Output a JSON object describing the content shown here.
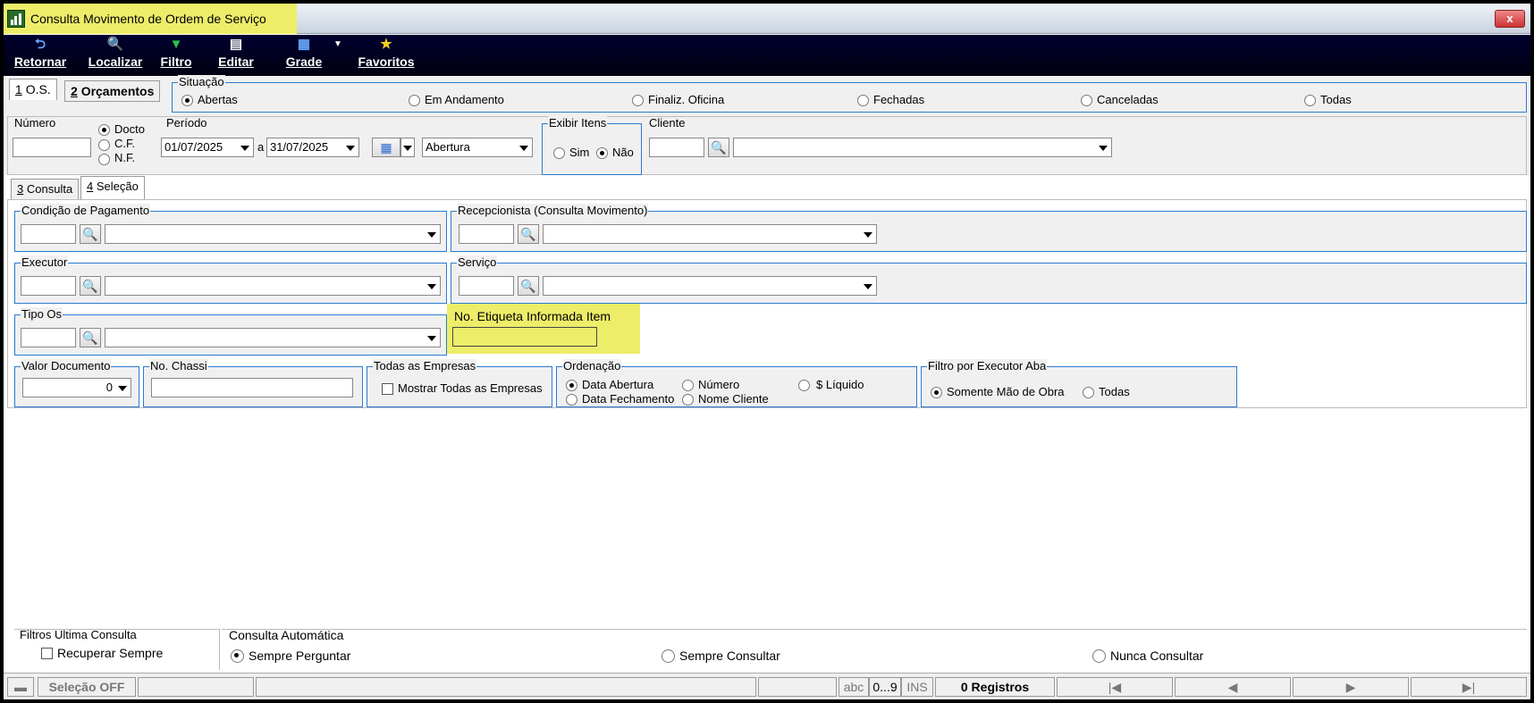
{
  "window": {
    "title": "Consulta Movimento de Ordem de Serviço",
    "close_label": "x"
  },
  "toolbar": {
    "retornar": "Retornar",
    "localizar": "Localizar",
    "filtro": "Filtro",
    "editar": "Editar",
    "grade": "Grade",
    "favoritos": "Favoritos"
  },
  "tabs_top": [
    {
      "key": "1",
      "label": "O.S."
    },
    {
      "key": "2",
      "label": "Orçamentos"
    }
  ],
  "situacao": {
    "label": "Situação",
    "options": [
      "Abertas",
      "Em Andamento",
      "Finaliz. Oficina",
      "Fechadas",
      "Canceladas",
      "Todas"
    ],
    "selected": "Abertas"
  },
  "numero": {
    "label": "Número",
    "value": "",
    "options": [
      "Docto",
      "C.F.",
      "N.F."
    ],
    "selected": "Docto"
  },
  "periodo": {
    "label": "Período",
    "from": "01/07/2025",
    "sep": "a",
    "to": "31/07/2025",
    "type": "Abertura"
  },
  "exibir_itens": {
    "label": "Exibir Itens",
    "options": [
      "Sim",
      "Não"
    ],
    "selected": "Não"
  },
  "cliente": {
    "label": "Cliente",
    "code": "",
    "name": ""
  },
  "tabs_mid": [
    {
      "key": "3",
      "label": "Consulta"
    },
    {
      "key": "4",
      "label": "Seleção"
    }
  ],
  "fields": {
    "condicao_pagamento": "Condição de Pagamento",
    "recepcionista": "Recepcionista (Consulta Movimento)",
    "executor": "Executor",
    "servico": "Serviço",
    "tipo_os": "Tipo Os",
    "etiqueta": "No. Etiqueta Informada Item"
  },
  "valor_documento": {
    "label": "Valor Documento",
    "value": "0"
  },
  "chassi": {
    "label": "No. Chassi",
    "value": ""
  },
  "todas_empresas": {
    "label": "Todas as Empresas",
    "checkbox": "Mostrar Todas as Empresas"
  },
  "ordenacao": {
    "label": "Ordenação",
    "options": [
      "Data Abertura",
      "Número",
      "$ Líquido",
      "Data Fechamento",
      "Nome Cliente"
    ],
    "selected": "Data Abertura"
  },
  "filtro_executor": {
    "label": "Filtro por Executor Aba",
    "options": [
      "Somente Mão de Obra",
      "Todas"
    ],
    "selected": "Somente Mão de Obra"
  },
  "filtros_ultima": {
    "label": "Filtros Ultima Consulta",
    "checkbox": "Recuperar Sempre"
  },
  "consulta_auto": {
    "label": "Consulta Automática",
    "options": [
      "Sempre Perguntar",
      "Sempre Consultar",
      "Nunca Consultar"
    ],
    "selected": "Sempre Perguntar"
  },
  "status": {
    "selecao": "Seleção OFF",
    "abc": "abc",
    "num": "0...9",
    "ins": "INS",
    "registros": "0 Registros"
  },
  "colors": {
    "accent_border": "#2a7bd0",
    "highlight": "#eded6a",
    "toolbar_bg": "#000030"
  }
}
